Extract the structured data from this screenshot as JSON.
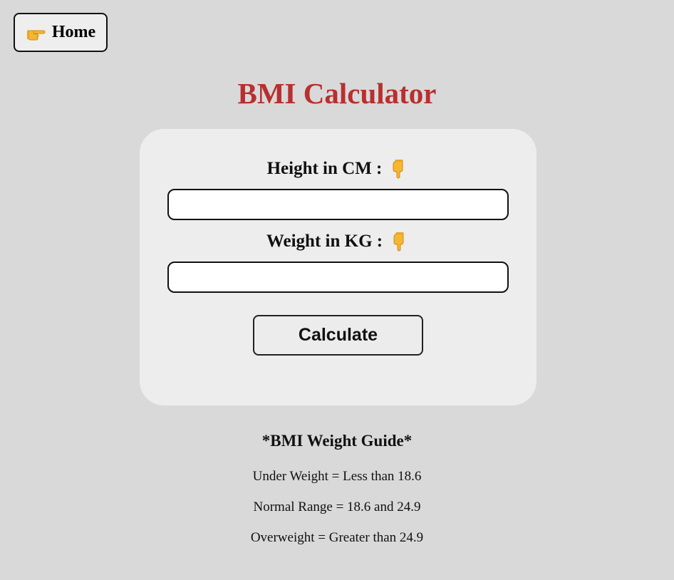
{
  "nav": {
    "home_label": "Home",
    "home_icon": "pointing-right-hand-icon"
  },
  "page": {
    "title": "BMI Calculator",
    "title_color": "#b82f2f",
    "background": "#d9d9d9"
  },
  "form": {
    "height_label": "Height in CM :",
    "weight_label": "Weight in KG :",
    "label_icon": "pointing-down-hand-icon",
    "height_value": "",
    "height_placeholder": "",
    "weight_value": "",
    "weight_placeholder": "",
    "calculate_label": "Calculate"
  },
  "guide": {
    "title": "*BMI Weight Guide*",
    "lines": [
      "Under Weight = Less than 18.6",
      "Normal Range = 18.6 and 24.9",
      "Overweight = Greater than 24.9"
    ]
  }
}
